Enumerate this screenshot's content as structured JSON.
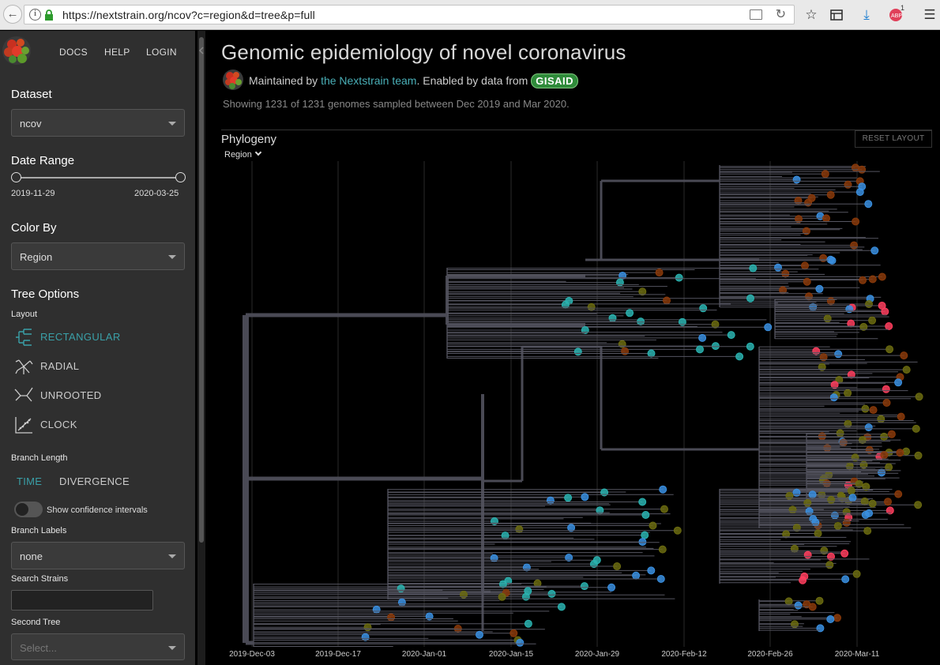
{
  "browser": {
    "url": "https://nextstrain.org/ncov?c=region&d=tree&p=full",
    "badge": "1"
  },
  "nav": {
    "docs": "DOCS",
    "help": "HELP",
    "login": "LOGIN"
  },
  "sidebar": {
    "dataset_label": "Dataset",
    "dataset_value": "ncov",
    "date_range_label": "Date Range",
    "date_start": "2019-11-29",
    "date_end": "2020-03-25",
    "color_by_label": "Color By",
    "color_by_value": "Region",
    "tree_options_label": "Tree Options",
    "layout_label": "Layout",
    "layouts": [
      "RECTANGULAR",
      "RADIAL",
      "UNROOTED",
      "CLOCK"
    ],
    "active_layout": "RECTANGULAR",
    "branch_length_label": "Branch Length",
    "branch_length_options": [
      "TIME",
      "DIVERGENCE"
    ],
    "active_branch_length": "TIME",
    "confidence_label": "Show confidence intervals",
    "branch_labels_label": "Branch Labels",
    "branch_labels_value": "none",
    "search_label": "Search Strains",
    "second_tree_label": "Second Tree",
    "second_tree_placeholder": "Select..."
  },
  "main": {
    "title": "Genomic epidemiology of novel coronavirus",
    "maintained_prefix": "Maintained by ",
    "maintained_link": "the Nextstrain team",
    "enabled_text": ". Enabled by data from ",
    "gisaid": "GISAID",
    "showing": "Showing 1231 of 1231 genomes sampled between Dec 2019 and Mar 2020.",
    "panel_title": "Phylogeny",
    "reset_layout": "RESET LAYOUT",
    "tree_color_by": "Region",
    "x_ticks": [
      "2019-Dec-03",
      "2019-Dec-17",
      "2020-Jan-01",
      "2020-Jan-15",
      "2020-Jan-29",
      "2020-Feb-12",
      "2020-Feb-26",
      "2020-Mar-11"
    ]
  },
  "colors": {
    "sidebar_bg": "#2f2f2f",
    "accent": "#3aa0a8",
    "branch": "#4a4a55",
    "region_asia": "#2ab3b0",
    "region_europe": "#6b6b10",
    "region_north_america": "#8a3a0a",
    "region_oceania": "#3a8fe0",
    "region_south_america": "#ff3e5e"
  }
}
